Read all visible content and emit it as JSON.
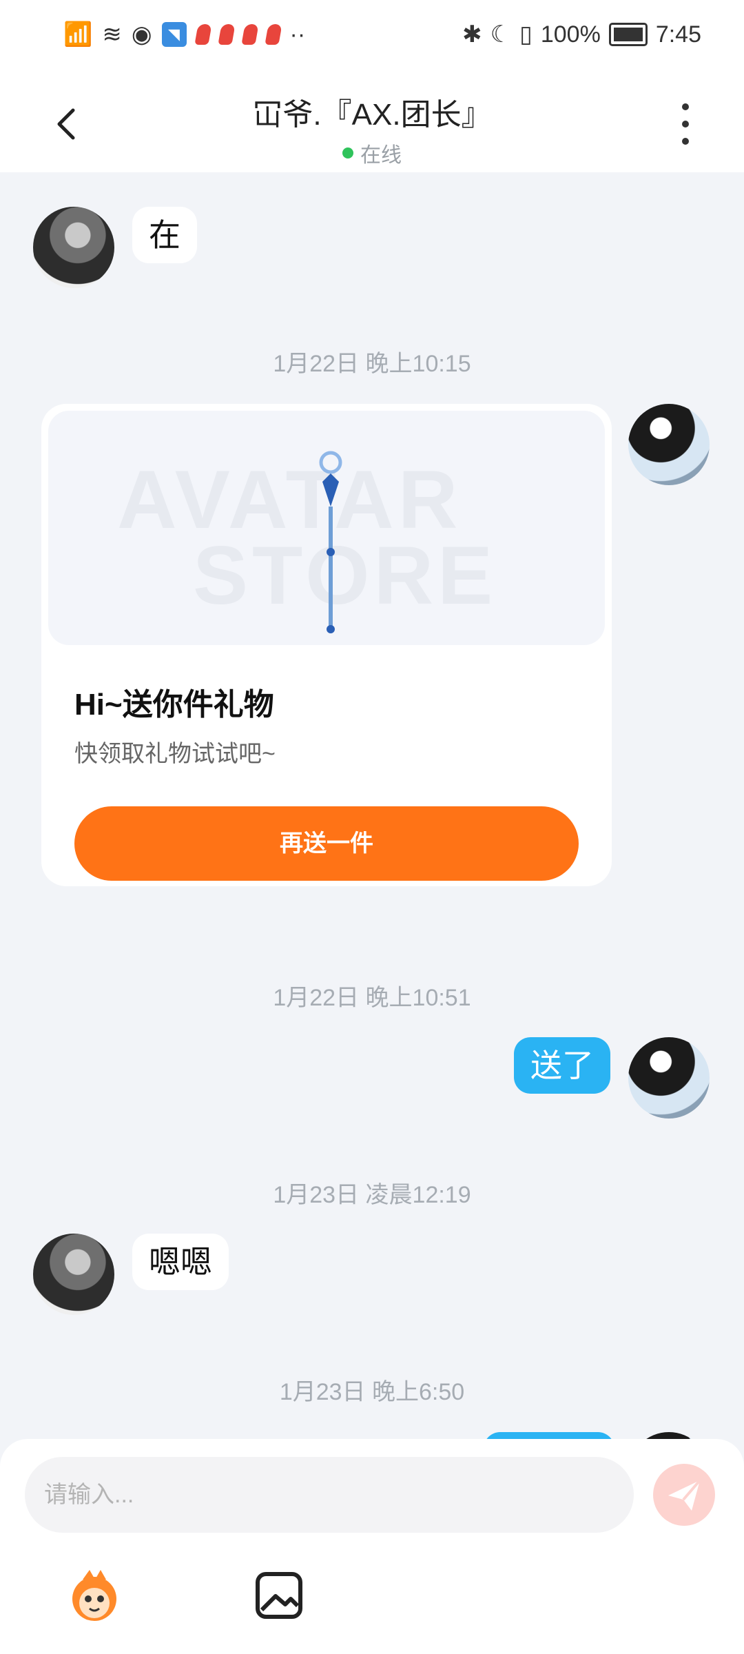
{
  "status_bar": {
    "battery": "100%",
    "time": "7:45"
  },
  "header": {
    "title": "冚爷.『AX.团长』",
    "status": "在线"
  },
  "timestamps": [
    "1月22日 晚上10:15",
    "1月22日 晚上10:51",
    "1月23日 凌晨12:19",
    "1月23日 晚上6:50"
  ],
  "messages": {
    "m1": "在",
    "m2": "送了",
    "m3": "嗯嗯"
  },
  "gift_card": {
    "watermark_line1": "AVATAR",
    "watermark_line2": "STORE",
    "title": "Hi~送你件礼物",
    "subtitle": "快领取礼物试试吧~",
    "button": "再送一件"
  },
  "input": {
    "placeholder": "请输入..."
  },
  "colors": {
    "accent_orange": "#ff7316",
    "bubble_blue": "#2ab3f3",
    "online_green": "#2fc35b"
  },
  "icons": [
    "back-arrow-icon",
    "more-vertical-icon",
    "send-icon",
    "emoji-mascot-icon",
    "image-icon"
  ]
}
